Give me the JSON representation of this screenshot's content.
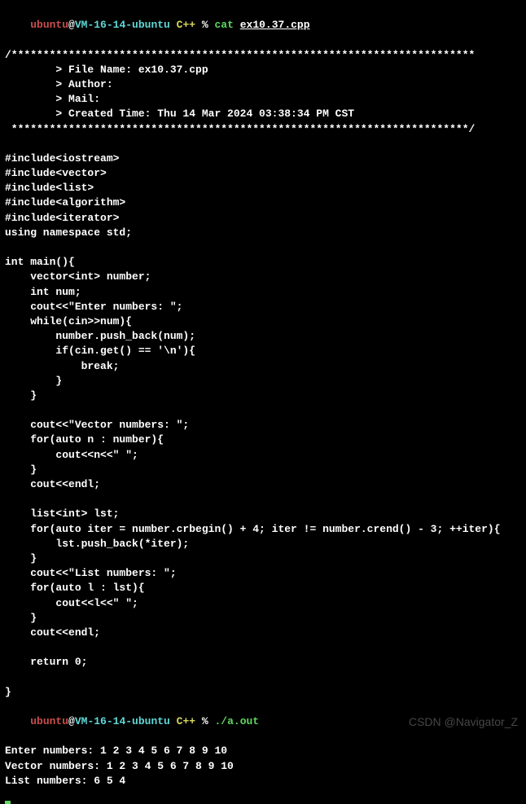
{
  "prompt1": {
    "user": "ubuntu",
    "at": "@",
    "host": "VM-16-14-ubuntu",
    "cwd": " C++ ",
    "sep": "% ",
    "cmd": "cat ",
    "arg": "ex10.37.cpp"
  },
  "header": {
    "open": "/*************************************************************************",
    "file": "        > File Name: ex10.37.cpp",
    "author": "        > Author: ",
    "mail": "        > Mail: ",
    "created": "        > Created Time: Thu 14 Mar 2024 03:38:34 PM CST",
    "close": " ************************************************************************/"
  },
  "code": [
    "",
    "#include<iostream>",
    "#include<vector>",
    "#include<list>",
    "#include<algorithm>",
    "#include<iterator>",
    "using namespace std;",
    "",
    "int main(){",
    "    vector<int> number;",
    "    int num;",
    "    cout<<\"Enter numbers: \";",
    "    while(cin>>num){",
    "        number.push_back(num);",
    "        if(cin.get() == '\\n'){",
    "            break;",
    "        }",
    "    }",
    "",
    "    cout<<\"Vector numbers: \";",
    "    for(auto n : number){",
    "        cout<<n<<\" \";",
    "    }",
    "    cout<<endl;",
    "",
    "    list<int> lst;",
    "    for(auto iter = number.crbegin() + 4; iter != number.crend() - 3; ++iter){",
    "        lst.push_back(*iter);",
    "    }",
    "    cout<<\"List numbers: \";",
    "    for(auto l : lst){",
    "        cout<<l<<\" \";",
    "    }",
    "    cout<<endl;",
    "",
    "    return 0;",
    "",
    "}"
  ],
  "prompt2": {
    "user": "ubuntu",
    "at": "@",
    "host": "VM-16-14-ubuntu",
    "cwd": " C++ ",
    "sep": "% ",
    "cmd": "./a.out"
  },
  "output": [
    "Enter numbers: 1 2 3 4 5 6 7 8 9 10",
    "Vector numbers: 1 2 3 4 5 6 7 8 9 10",
    "List numbers: 6 5 4"
  ],
  "watermark": "CSDN @Navigator_Z"
}
